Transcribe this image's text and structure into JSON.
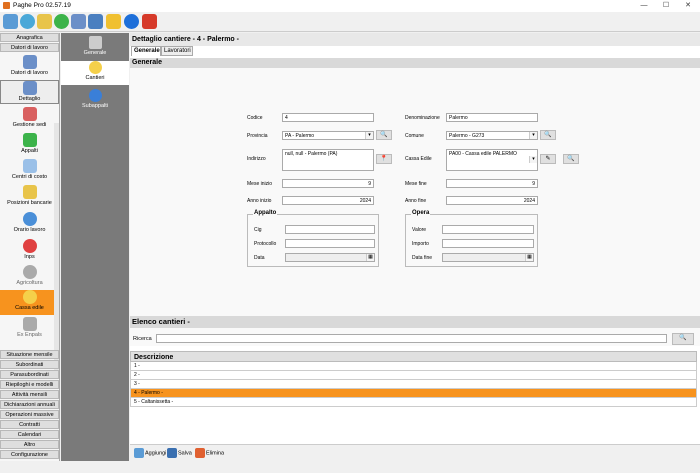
{
  "window": {
    "title": "Paghe Pro 02.57.19",
    "minimize": "—",
    "maximize": "☐",
    "close": "✕"
  },
  "toolbar_icons": [
    "home-icon",
    "sync-icon",
    "wizard-icon",
    "refresh-icon",
    "network-icon",
    "link-icon",
    "folder-icon",
    "info-icon",
    "exit-icon"
  ],
  "nav1": {
    "header_anagrafica": "Anagrafica",
    "header_datori": "Datori di lavoro",
    "items": [
      "Datori di lavoro",
      "Dettaglio",
      "Gestione sedi",
      "Appalti",
      "Centri di costo",
      "Posizioni bancarie",
      "Orario lavoro",
      "Inps",
      "Agricoltura",
      "Cassa edile",
      "Ex Enpals"
    ],
    "bottom": [
      "Situazione mensile",
      "Subordinati",
      "Parasubordinati",
      "Riepiloghi e modelli",
      "Attività mensili",
      "Dichiarazioni annuali",
      "Operazioni massive",
      "Contratti",
      "Calendari",
      "Altro",
      "Configurazione"
    ]
  },
  "nav2": {
    "items": [
      "Generale",
      "Cantieri",
      "Subappalti"
    ]
  },
  "main": {
    "title": "Dettaglio cantiere - 4 - Palermo -",
    "tabs": [
      "Generale",
      "Lavoratori"
    ],
    "section_generale": "Generale",
    "form": {
      "codice_label": "Codice",
      "codice": "4",
      "denominazione_label": "Denominazione",
      "denominazione": "Palermo",
      "provincia_label": "Provincia",
      "provincia": "PA - Palermo",
      "comune_label": "Comune",
      "comune": "Palermo - G273",
      "indirizzo_label": "Indirizzo",
      "indirizzo": "null, null - Palermo (PA)",
      "cassa_label": "Cassa Edile",
      "cassa": "PA00 - Cassa edile PALERMO",
      "mese_inizio_label": "Mese inizio",
      "mese_inizio": "9",
      "mese_fine_label": "Mese fine",
      "mese_fine": "9",
      "anno_inizio_label": "Anno inizio",
      "anno_inizio": "2024",
      "anno_fine_label": "Anno fine",
      "anno_fine": "2024",
      "appalto": {
        "title": "Appalto",
        "cig": "Cig",
        "protocollo": "Protocollo",
        "data": "Data"
      },
      "opera": {
        "title": "Opera",
        "valore": "Valore",
        "importo": "Importo",
        "data_fine": "Data fine"
      }
    },
    "section_elenco": "Elenco cantieri -",
    "ricerca_label": "Ricerca",
    "list": {
      "header": "Descrizione",
      "rows": [
        "1 -",
        "2 -",
        "3 -",
        "4 - Palermo -",
        "5 - Caltanissetta -"
      ]
    },
    "bottom_buttons": {
      "aggiungi": "Aggiungi",
      "salva": "Salva",
      "elimina": "Elimina"
    }
  },
  "colors": {
    "selection": "#f7931e",
    "nav2_bg": "#7a7a7a"
  }
}
